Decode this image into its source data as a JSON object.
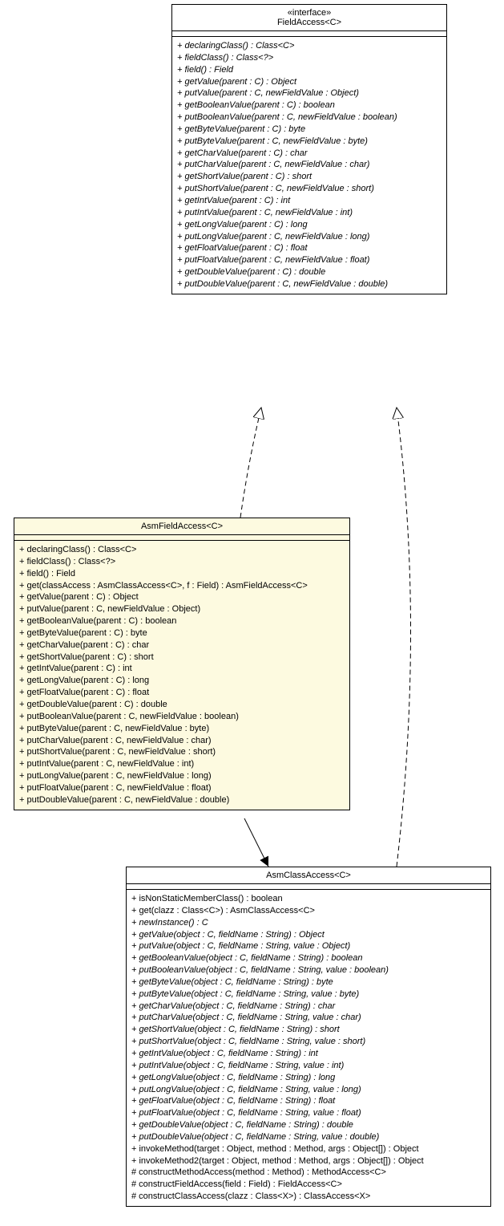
{
  "interface_box": {
    "stereotype": "«interface»",
    "name": "FieldAccess<C>",
    "ops": [
      {
        "sig": "+ declaringClass() : Class<C>",
        "abstract": true
      },
      {
        "sig": "+ fieldClass() : Class<?>",
        "abstract": true
      },
      {
        "sig": "+ field() : Field",
        "abstract": true
      },
      {
        "sig": "+ getValue(parent : C) : Object",
        "abstract": true
      },
      {
        "sig": "+ putValue(parent : C, newFieldValue : Object)",
        "abstract": true
      },
      {
        "sig": "+ getBooleanValue(parent : C) : boolean",
        "abstract": true
      },
      {
        "sig": "+ putBooleanValue(parent : C, newFieldValue : boolean)",
        "abstract": true
      },
      {
        "sig": "+ getByteValue(parent : C) : byte",
        "abstract": true
      },
      {
        "sig": "+ putByteValue(parent : C, newFieldValue : byte)",
        "abstract": true
      },
      {
        "sig": "+ getCharValue(parent : C) : char",
        "abstract": true
      },
      {
        "sig": "+ putCharValue(parent : C, newFieldValue : char)",
        "abstract": true
      },
      {
        "sig": "+ getShortValue(parent : C) : short",
        "abstract": true
      },
      {
        "sig": "+ putShortValue(parent : C, newFieldValue : short)",
        "abstract": true
      },
      {
        "sig": "+ getIntValue(parent : C) : int",
        "abstract": true
      },
      {
        "sig": "+ putIntValue(parent : C, newFieldValue : int)",
        "abstract": true
      },
      {
        "sig": "+ getLongValue(parent : C) : long",
        "abstract": true
      },
      {
        "sig": "+ putLongValue(parent : C, newFieldValue : long)",
        "abstract": true
      },
      {
        "sig": "+ getFloatValue(parent : C) : float",
        "abstract": true
      },
      {
        "sig": "+ putFloatValue(parent : C, newFieldValue : float)",
        "abstract": true
      },
      {
        "sig": "+ getDoubleValue(parent : C) : double",
        "abstract": true
      },
      {
        "sig": "+ putDoubleValue(parent : C, newFieldValue : double)",
        "abstract": true
      }
    ]
  },
  "asm_field_box": {
    "name": "AsmFieldAccess<C>",
    "ops": [
      {
        "sig": "+ declaringClass() : Class<C>",
        "abstract": false
      },
      {
        "sig": "+ fieldClass() : Class<?>",
        "abstract": false
      },
      {
        "sig": "+ field() : Field",
        "abstract": false
      },
      {
        "sig": "+ get(classAccess : AsmClassAccess<C>, f : Field) : AsmFieldAccess<C>",
        "abstract": false
      },
      {
        "sig": "+ getValue(parent : C) : Object",
        "abstract": false
      },
      {
        "sig": "+ putValue(parent : C, newFieldValue : Object)",
        "abstract": false
      },
      {
        "sig": "+ getBooleanValue(parent : C) : boolean",
        "abstract": false
      },
      {
        "sig": "+ getByteValue(parent : C) : byte",
        "abstract": false
      },
      {
        "sig": "+ getCharValue(parent : C) : char",
        "abstract": false
      },
      {
        "sig": "+ getShortValue(parent : C) : short",
        "abstract": false
      },
      {
        "sig": "+ getIntValue(parent : C) : int",
        "abstract": false
      },
      {
        "sig": "+ getLongValue(parent : C) : long",
        "abstract": false
      },
      {
        "sig": "+ getFloatValue(parent : C) : float",
        "abstract": false
      },
      {
        "sig": "+ getDoubleValue(parent : C) : double",
        "abstract": false
      },
      {
        "sig": "+ putBooleanValue(parent : C, newFieldValue : boolean)",
        "abstract": false
      },
      {
        "sig": "+ putByteValue(parent : C, newFieldValue : byte)",
        "abstract": false
      },
      {
        "sig": "+ putCharValue(parent : C, newFieldValue : char)",
        "abstract": false
      },
      {
        "sig": "+ putShortValue(parent : C, newFieldValue : short)",
        "abstract": false
      },
      {
        "sig": "+ putIntValue(parent : C, newFieldValue : int)",
        "abstract": false
      },
      {
        "sig": "+ putLongValue(parent : C, newFieldValue : long)",
        "abstract": false
      },
      {
        "sig": "+ putFloatValue(parent : C, newFieldValue : float)",
        "abstract": false
      },
      {
        "sig": "+ putDoubleValue(parent : C, newFieldValue : double)",
        "abstract": false
      }
    ]
  },
  "asm_class_box": {
    "name": "AsmClassAccess<C>",
    "ops": [
      {
        "sig": "+ isNonStaticMemberClass() : boolean",
        "abstract": false
      },
      {
        "sig": "+ get(clazz : Class<C>) : AsmClassAccess<C>",
        "abstract": false
      },
      {
        "sig": "+ newInstance() : C",
        "abstract": true
      },
      {
        "sig": "+ getValue(object : C, fieldName : String) : Object",
        "abstract": true
      },
      {
        "sig": "+ putValue(object : C, fieldName : String, value : Object)",
        "abstract": true
      },
      {
        "sig": "+ getBooleanValue(object : C, fieldName : String) : boolean",
        "abstract": true
      },
      {
        "sig": "+ putBooleanValue(object : C, fieldName : String, value : boolean)",
        "abstract": true
      },
      {
        "sig": "+ getByteValue(object : C, fieldName : String) : byte",
        "abstract": true
      },
      {
        "sig": "+ putByteValue(object : C, fieldName : String, value : byte)",
        "abstract": true
      },
      {
        "sig": "+ getCharValue(object : C, fieldName : String) : char",
        "abstract": true
      },
      {
        "sig": "+ putCharValue(object : C, fieldName : String, value : char)",
        "abstract": true
      },
      {
        "sig": "+ getShortValue(object : C, fieldName : String) : short",
        "abstract": true
      },
      {
        "sig": "+ putShortValue(object : C, fieldName : String, value : short)",
        "abstract": true
      },
      {
        "sig": "+ getIntValue(object : C, fieldName : String) : int",
        "abstract": true
      },
      {
        "sig": "+ putIntValue(object : C, fieldName : String, value : int)",
        "abstract": true
      },
      {
        "sig": "+ getLongValue(object : C, fieldName : String) : long",
        "abstract": true
      },
      {
        "sig": "+ putLongValue(object : C, fieldName : String, value : long)",
        "abstract": true
      },
      {
        "sig": "+ getFloatValue(object : C, fieldName : String) : float",
        "abstract": true
      },
      {
        "sig": "+ putFloatValue(object : C, fieldName : String, value : float)",
        "abstract": true
      },
      {
        "sig": "+ getDoubleValue(object : C, fieldName : String) : double",
        "abstract": true
      },
      {
        "sig": "+ putDoubleValue(object : C, fieldName : String, value : double)",
        "abstract": true
      },
      {
        "sig": "+ invokeMethod(target : Object, method : Method, args : Object[]) : Object",
        "abstract": false
      },
      {
        "sig": "+ invokeMethod2(target : Object, method : Method, args : Object[]) : Object",
        "abstract": false
      },
      {
        "sig": "# constructMethodAccess(method : Method) : MethodAccess<C>",
        "abstract": false
      },
      {
        "sig": "# constructFieldAccess(field : Field) : FieldAccess<C>",
        "abstract": false
      },
      {
        "sig": "# constructClassAccess(clazz : Class<X>) : ClassAccess<X>",
        "abstract": false
      }
    ]
  }
}
